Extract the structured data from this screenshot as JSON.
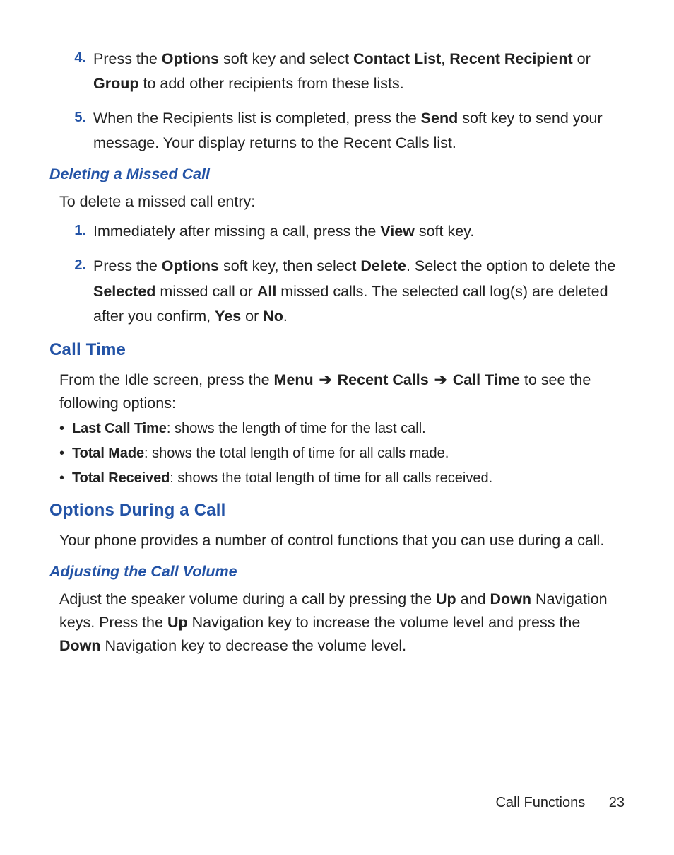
{
  "list_top": {
    "items": [
      {
        "num": "4.",
        "parts": [
          {
            "t": "Press the "
          },
          {
            "t": "Options",
            "b": true
          },
          {
            "t": " soft key and select "
          },
          {
            "t": "Contact List",
            "b": true
          },
          {
            "t": ", "
          },
          {
            "t": "Recent Recipient",
            "b": true
          },
          {
            "t": " or "
          },
          {
            "t": "Group",
            "b": true
          },
          {
            "t": " to add other recipients from these lists."
          }
        ]
      },
      {
        "num": "5.",
        "parts": [
          {
            "t": "When the Recipients list is completed, press the "
          },
          {
            "t": "Send",
            "b": true
          },
          {
            "t": " soft key to send your message. Your display returns to the Recent Calls list."
          }
        ]
      }
    ]
  },
  "sec_delete": {
    "heading": "Deleting a Missed Call",
    "intro": "To delete a missed call entry:",
    "items": [
      {
        "num": "1.",
        "parts": [
          {
            "t": "Immediately after missing a call, press the "
          },
          {
            "t": "View",
            "b": true
          },
          {
            "t": " soft key."
          }
        ]
      },
      {
        "num": "2.",
        "parts": [
          {
            "t": "Press the "
          },
          {
            "t": "Options",
            "b": true
          },
          {
            "t": " soft key, then select "
          },
          {
            "t": "Delete",
            "b": true
          },
          {
            "t": ". Select the option to delete the "
          },
          {
            "t": "Selected",
            "b": true
          },
          {
            "t": " missed call or "
          },
          {
            "t": "All",
            "b": true
          },
          {
            "t": " missed calls. The selected call log(s) are deleted after you confirm, "
          },
          {
            "t": "Yes",
            "b": true
          },
          {
            "t": " or "
          },
          {
            "t": "No",
            "b": true
          },
          {
            "t": "."
          }
        ]
      }
    ]
  },
  "sec_calltime": {
    "heading": "Call Time",
    "intro_parts": [
      {
        "t": "From the Idle screen, press the "
      },
      {
        "t": "Menu",
        "b": true
      },
      {
        "t": " ",
        "arrow": true
      },
      {
        "t": "Recent Calls",
        "b": true
      },
      {
        "t": " ",
        "arrow": true
      },
      {
        "t": "Call Time",
        "b": true
      },
      {
        "t": " to see the following options:"
      }
    ],
    "bullets": [
      {
        "lead": "Last Call Time",
        "tail": ": shows the length of time for the last call."
      },
      {
        "lead": "Total Made",
        "tail": ": shows the total length of time for all calls made."
      },
      {
        "lead": "Total Received",
        "tail": ": shows the total length of time for all calls received."
      }
    ]
  },
  "sec_options": {
    "heading": "Options During a Call",
    "intro": "Your phone provides a number of control functions that you can use during a call."
  },
  "sec_volume": {
    "heading": "Adjusting the Call Volume",
    "parts": [
      {
        "t": "Adjust the speaker volume during a call by pressing the "
      },
      {
        "t": "Up",
        "b": true
      },
      {
        "t": " and "
      },
      {
        "t": "Down",
        "b": true
      },
      {
        "t": " Navigation keys. Press the "
      },
      {
        "t": "Up",
        "b": true
      },
      {
        "t": " Navigation key to increase the volume level and press the "
      },
      {
        "t": "Down",
        "b": true
      },
      {
        "t": " Navigation key to decrease the volume level."
      }
    ]
  },
  "footer": {
    "section": "Call Functions",
    "page": "23"
  },
  "glyphs": {
    "arrow": "➔",
    "bullet": "•"
  }
}
